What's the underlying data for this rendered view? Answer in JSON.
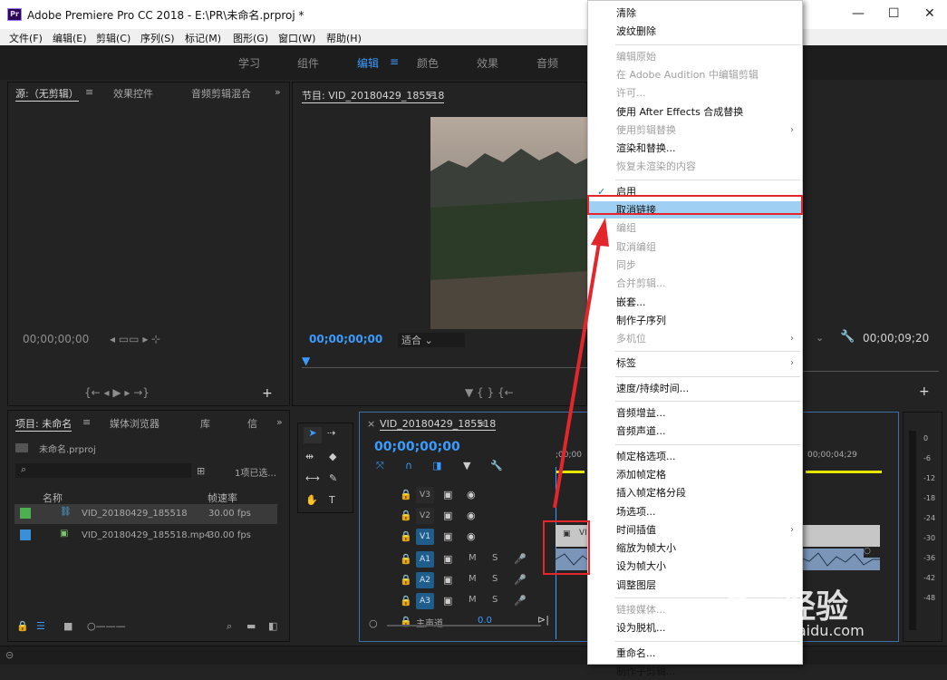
{
  "app": {
    "title": "Adobe Premiere Pro CC 2018 - E:\\PR\\未命名.prproj *",
    "icon_label": "Pr"
  },
  "menubar": [
    "文件(F)",
    "编辑(E)",
    "剪辑(C)",
    "序列(S)",
    "标记(M)",
    "图形(G)",
    "窗口(W)",
    "帮助(H)"
  ],
  "window_controls": {
    "minimize": "—",
    "maximize": "☐",
    "close": "✕"
  },
  "workspace_tabs": [
    {
      "label": "学习",
      "active": false
    },
    {
      "label": "组件",
      "active": false
    },
    {
      "label": "编辑",
      "active": true
    },
    {
      "label": "颜色",
      "active": false
    },
    {
      "label": "效果",
      "active": false
    },
    {
      "label": "音频",
      "active": false
    }
  ],
  "source_panel": {
    "tabs": [
      "源:（无剪辑）",
      "效果控件",
      "音频剪辑混合"
    ],
    "more": "»",
    "timecode": "00;00;00;00"
  },
  "program_panel": {
    "title": "节目: VID_20180429_185518",
    "timecode": "00;00;00;00",
    "fit": "适合",
    "end_timecode": "00;00;09;20"
  },
  "project_panel": {
    "tabs": [
      "项目: 未命名",
      "媒体浏览器",
      "库",
      "信"
    ],
    "more": "»",
    "project_file": "未命名.prproj",
    "selection": "1项已选...",
    "columns": {
      "name": "名称",
      "fps": "帧速率"
    },
    "items": [
      {
        "name": "VID_20180429_185518",
        "fps": "30.00 fps",
        "color": "#4caf50",
        "selected": true
      },
      {
        "name": "VID_20180429_185518.mp4",
        "fps": "30.00 fps",
        "color": "#3b8fd6",
        "selected": false
      }
    ]
  },
  "timeline_panel": {
    "tab": "VID_20180429_185518",
    "timecode": "00;00;00;00",
    "ruler_start": ";00;00",
    "ruler_end": "00;00;04;29",
    "tracks": [
      {
        "name": "V3",
        "type": "video",
        "active": false
      },
      {
        "name": "V2",
        "type": "video",
        "active": false
      },
      {
        "name": "V1",
        "type": "video",
        "active": true
      },
      {
        "name": "A1",
        "type": "audio",
        "active": true
      },
      {
        "name": "A2",
        "type": "audio",
        "active": true
      },
      {
        "name": "A3",
        "type": "audio",
        "active": true
      }
    ],
    "master": "主声道",
    "master_value": "0.0",
    "clip_label": "VI"
  },
  "meter_ticks": [
    "0",
    "-6",
    "-12",
    "-18",
    "-24",
    "-30",
    "-36",
    "-42",
    "-48"
  ],
  "context_menu": {
    "items": [
      {
        "label": "清除",
        "disabled": false
      },
      {
        "label": "波纹删除",
        "disabled": false
      },
      {
        "sep": true
      },
      {
        "label": "编辑原始",
        "disabled": true
      },
      {
        "label": "在 Adobe Audition 中编辑剪辑",
        "disabled": true
      },
      {
        "label": "许可...",
        "disabled": true
      },
      {
        "label": "使用 After Effects 合成替换",
        "disabled": false
      },
      {
        "label": "使用剪辑替换",
        "disabled": true,
        "submenu": true
      },
      {
        "label": "渲染和替换...",
        "disabled": false
      },
      {
        "label": "恢复未渲染的内容",
        "disabled": true
      },
      {
        "sep": true
      },
      {
        "label": "启用",
        "disabled": false,
        "checked": true
      },
      {
        "label": "取消链接",
        "disabled": false,
        "highlighted": true
      },
      {
        "label": "编组",
        "disabled": true
      },
      {
        "label": "取消编组",
        "disabled": true
      },
      {
        "label": "同步",
        "disabled": true
      },
      {
        "label": "合并剪辑...",
        "disabled": true
      },
      {
        "label": "嵌套...",
        "disabled": false
      },
      {
        "label": "制作子序列",
        "disabled": false
      },
      {
        "label": "多机位",
        "disabled": true,
        "submenu": true
      },
      {
        "sep": true
      },
      {
        "label": "标签",
        "disabled": false,
        "submenu": true
      },
      {
        "sep": true
      },
      {
        "label": "速度/持续时间...",
        "disabled": false
      },
      {
        "sep": true
      },
      {
        "label": "音频增益...",
        "disabled": false
      },
      {
        "label": "音频声道...",
        "disabled": false
      },
      {
        "sep": true
      },
      {
        "label": "帧定格选项...",
        "disabled": false
      },
      {
        "label": "添加帧定格",
        "disabled": false
      },
      {
        "label": "插入帧定格分段",
        "disabled": false
      },
      {
        "label": "场选项...",
        "disabled": false
      },
      {
        "label": "时间插值",
        "disabled": false,
        "submenu": true
      },
      {
        "label": "缩放为帧大小",
        "disabled": false
      },
      {
        "label": "设为帧大小",
        "disabled": false
      },
      {
        "label": "调整图层",
        "disabled": false
      },
      {
        "sep": true
      },
      {
        "label": "链接媒体...",
        "disabled": true
      },
      {
        "label": "设为脱机...",
        "disabled": false
      },
      {
        "sep": true
      },
      {
        "label": "重命名...",
        "disabled": false
      },
      {
        "label": "制作子剪辑...",
        "disabled": false
      }
    ]
  },
  "watermark": {
    "brand": "Bai经验",
    "url": "jingyan.baidu.com"
  },
  "colors": {
    "accent": "#3b9cff",
    "highlight": "#9fcff2",
    "annotation": "#e2262b",
    "playhead_bar": "#e6e600"
  }
}
